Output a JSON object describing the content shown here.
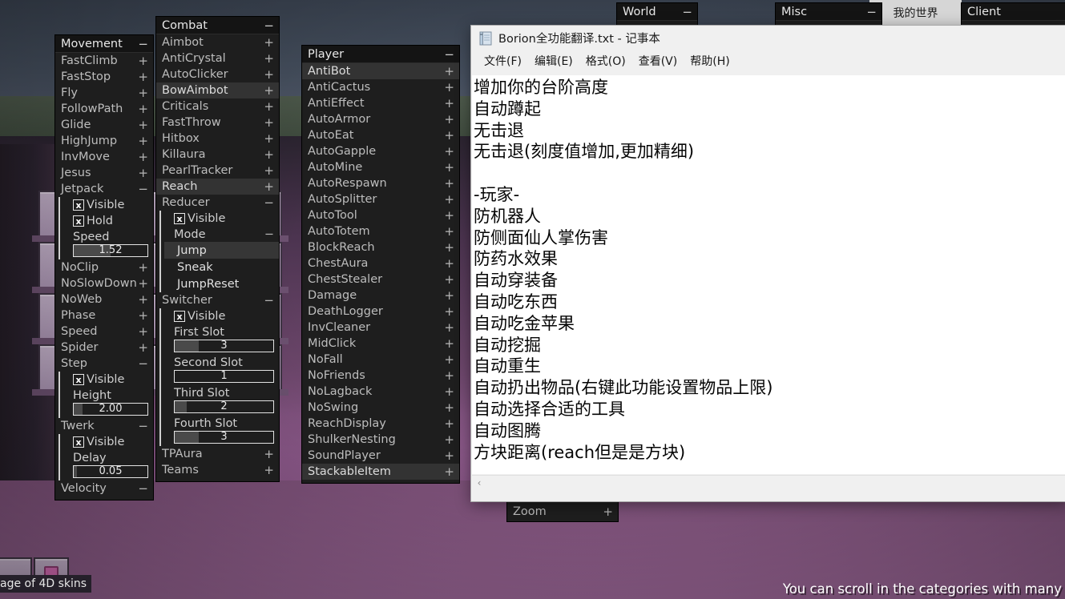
{
  "background": {
    "hud_hint": "You can scroll in the categories with many",
    "skin_tooltip": "age of 4D skins",
    "mc_window_label": "我的世界"
  },
  "panels": {
    "movement": {
      "title": "Movement",
      "toggle": "−",
      "items": [
        {
          "label": "FastClimb",
          "sym": "+"
        },
        {
          "label": "FastStop",
          "sym": "+"
        },
        {
          "label": "Fly",
          "sym": "+"
        },
        {
          "label": "FollowPath",
          "sym": "+"
        },
        {
          "label": "Glide",
          "sym": "+"
        },
        {
          "label": "HighJump",
          "sym": "+"
        },
        {
          "label": "InvMove",
          "sym": "+"
        },
        {
          "label": "Jesus",
          "sym": "+"
        },
        {
          "label": "Jetpack",
          "sym": "−"
        }
      ],
      "jetpack_settings": {
        "visible_label": "Visible",
        "visible_checked": "x",
        "hold_label": "Hold",
        "hold_checked": "x",
        "speed_label": "Speed",
        "speed_value": "1.52",
        "speed_fill_pct": 50
      },
      "items2": [
        {
          "label": "NoClip",
          "sym": "+"
        },
        {
          "label": "NoSlowDown",
          "sym": "+"
        },
        {
          "label": "NoWeb",
          "sym": "+"
        },
        {
          "label": "Phase",
          "sym": "+"
        },
        {
          "label": "Speed",
          "sym": "+"
        },
        {
          "label": "Spider",
          "sym": "+"
        },
        {
          "label": "Step",
          "sym": "−"
        }
      ],
      "step_settings": {
        "visible_label": "Visible",
        "visible_checked": "x",
        "height_label": "Height",
        "height_value": "2.00",
        "height_fill_pct": 12
      },
      "items3": [
        {
          "label": "Twerk",
          "sym": "−"
        }
      ],
      "twerk_settings": {
        "visible_label": "Visible",
        "visible_checked": "x",
        "delay_label": "Delay",
        "delay_value": "0.05",
        "delay_fill_pct": 4
      },
      "items4": [
        {
          "label": "Velocity",
          "sym": "−"
        }
      ]
    },
    "combat": {
      "title": "Combat",
      "toggle": "−",
      "items": [
        {
          "label": "Aimbot",
          "sym": "+",
          "selected": false
        },
        {
          "label": "AntiCrystal",
          "sym": "+",
          "selected": false
        },
        {
          "label": "AutoClicker",
          "sym": "+",
          "selected": false
        },
        {
          "label": "BowAimbot",
          "sym": "+",
          "selected": true
        },
        {
          "label": "Criticals",
          "sym": "+",
          "selected": false
        },
        {
          "label": "FastThrow",
          "sym": "+",
          "selected": false
        },
        {
          "label": "Hitbox",
          "sym": "+",
          "selected": false
        },
        {
          "label": "Killaura",
          "sym": "+",
          "selected": false
        },
        {
          "label": "PearlTracker",
          "sym": "+",
          "selected": false
        },
        {
          "label": "Reach",
          "sym": "+",
          "selected": true
        },
        {
          "label": "Reducer",
          "sym": "−",
          "selected": false
        }
      ],
      "reducer_settings": {
        "visible_label": "Visible",
        "visible_checked": "x",
        "mode_label": "Mode",
        "mode_toggle": "−",
        "modes": [
          {
            "label": "Jump",
            "active": true
          },
          {
            "label": "Sneak",
            "active": false
          },
          {
            "label": "JumpReset",
            "active": false
          }
        ]
      },
      "switcher": {
        "label": "Switcher",
        "toggle": "−",
        "visible_label": "Visible",
        "visible_checked": "x",
        "slots": [
          {
            "label": "First Slot",
            "value": "3",
            "fill_pct": 24
          },
          {
            "label": "Second Slot",
            "value": "1",
            "fill_pct": 0
          },
          {
            "label": "Third Slot",
            "value": "2",
            "fill_pct": 12
          },
          {
            "label": "Fourth Slot",
            "value": "3",
            "fill_pct": 24
          }
        ]
      },
      "items_tail": [
        {
          "label": "TPAura",
          "sym": "+"
        },
        {
          "label": "Teams",
          "sym": "+"
        }
      ]
    },
    "player": {
      "title": "Player",
      "toggle": "−",
      "items": [
        {
          "label": "AntiBot",
          "sym": "+",
          "selected": true
        },
        {
          "label": "AntiCactus",
          "sym": "+",
          "selected": false
        },
        {
          "label": "AntiEffect",
          "sym": "+",
          "selected": false
        },
        {
          "label": "AutoArmor",
          "sym": "+",
          "selected": false
        },
        {
          "label": "AutoEat",
          "sym": "+",
          "selected": false
        },
        {
          "label": "AutoGapple",
          "sym": "+",
          "selected": false
        },
        {
          "label": "AutoMine",
          "sym": "+",
          "selected": false
        },
        {
          "label": "AutoRespawn",
          "sym": "+",
          "selected": false
        },
        {
          "label": "AutoSplitter",
          "sym": "+",
          "selected": false
        },
        {
          "label": "AutoTool",
          "sym": "+",
          "selected": false
        },
        {
          "label": "AutoTotem",
          "sym": "+",
          "selected": false
        },
        {
          "label": "BlockReach",
          "sym": "+",
          "selected": false
        },
        {
          "label": "ChestAura",
          "sym": "+",
          "selected": false
        },
        {
          "label": "ChestStealer",
          "sym": "+",
          "selected": false
        },
        {
          "label": "Damage",
          "sym": "+",
          "selected": false
        },
        {
          "label": "DeathLogger",
          "sym": "+",
          "selected": false
        },
        {
          "label": "InvCleaner",
          "sym": "+",
          "selected": false
        },
        {
          "label": "MidClick",
          "sym": "+",
          "selected": false
        },
        {
          "label": "NoFall",
          "sym": "+",
          "selected": false
        },
        {
          "label": "NoFriends",
          "sym": "+",
          "selected": false
        },
        {
          "label": "NoLagback",
          "sym": "+",
          "selected": false
        },
        {
          "label": "NoSwing",
          "sym": "+",
          "selected": false
        },
        {
          "label": "ReachDisplay",
          "sym": "+",
          "selected": false
        },
        {
          "label": "ShulkerNesting",
          "sym": "+",
          "selected": false
        },
        {
          "label": "SoundPlayer",
          "sym": "+",
          "selected": false
        },
        {
          "label": "StackableItem",
          "sym": "+",
          "selected": true
        }
      ]
    },
    "world": {
      "title": "World",
      "toggle": "−"
    },
    "misc": {
      "title": "Misc",
      "toggle": "−",
      "last_item": "Zoom",
      "last_sym": "+"
    },
    "client": {
      "title": "Client",
      "toggle": ""
    }
  },
  "notepad": {
    "title": "Borion全功能翻译.txt - 记事本",
    "menu": [
      "文件(F)",
      "编辑(E)",
      "格式(O)",
      "查看(V)",
      "帮助(H)"
    ],
    "lines": [
      "增加你的台阶高度",
      "自动蹲起",
      "无击退",
      "无击退(刻度值增加,更加精细)",
      "",
      "-玩家-",
      "防机器人",
      "防侧面仙人掌伤害",
      "防药水效果",
      "自动穿装备",
      "自动吃东西",
      "自动吃金苹果",
      "自动挖掘",
      "自动重生",
      "自动扔出物品(右键此功能设置物品上限)",
      "自动选择合适的工具",
      "自动图腾",
      "方块距离(reach但是是方块)"
    ],
    "scroll_left_arrow": "‹"
  },
  "colors": {
    "panel_bg": "#1e1e1e",
    "panel_header": "#141414",
    "selected_row": "#333333",
    "text": "#bdbdbd",
    "notepad_bg": "#ffffff"
  }
}
